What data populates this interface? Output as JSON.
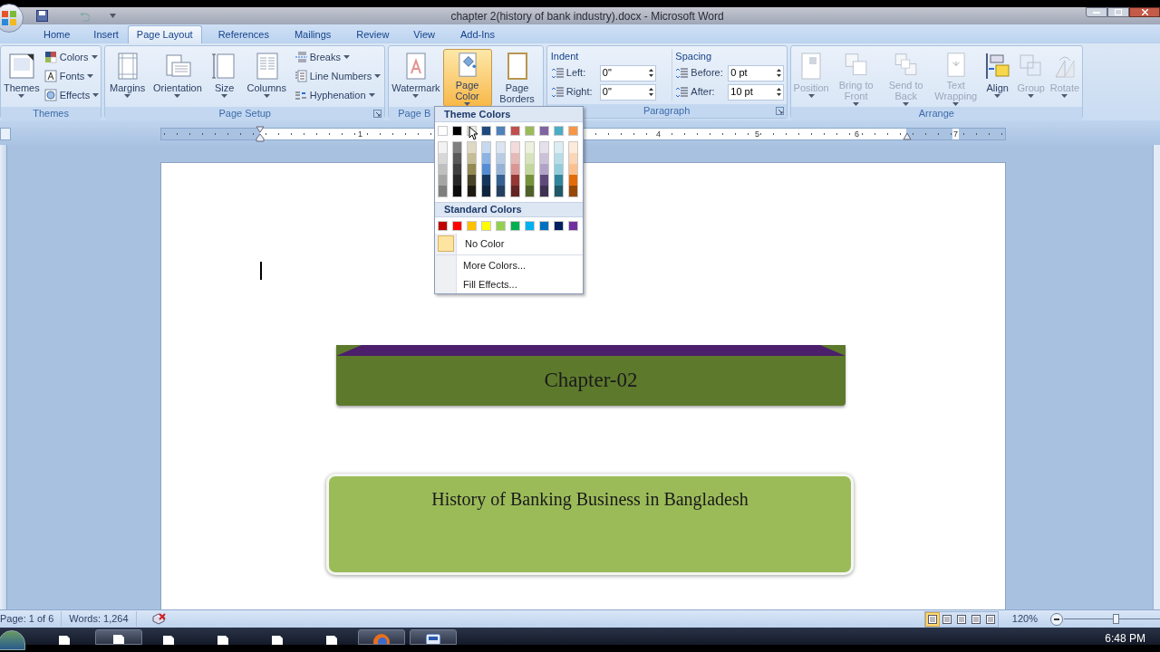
{
  "title_bar": {
    "title": "chapter 2(history of bank industry).docx - Microsoft Word"
  },
  "tabs": [
    {
      "label": "Home",
      "selected": false
    },
    {
      "label": "Insert",
      "selected": false
    },
    {
      "label": "Page Layout",
      "selected": true
    },
    {
      "label": "References",
      "selected": false
    },
    {
      "label": "Mailings",
      "selected": false
    },
    {
      "label": "Review",
      "selected": false
    },
    {
      "label": "View",
      "selected": false
    },
    {
      "label": "Add-Ins",
      "selected": false
    }
  ],
  "ribbon": {
    "groups": [
      {
        "label": "Themes",
        "label_clipped": false,
        "launcher": false,
        "items": [
          {
            "kind": "large",
            "label": "Themes",
            "dropdown": true,
            "disabled": false,
            "pressed": false
          },
          {
            "kind": "small_stack",
            "items": [
              {
                "label": "Colors",
                "dropdown": true
              },
              {
                "label": "Fonts",
                "dropdown": true
              },
              {
                "label": "Effects",
                "dropdown": true
              }
            ]
          }
        ]
      },
      {
        "label": "Page Setup",
        "label_clipped": false,
        "launcher": true,
        "items": [
          {
            "kind": "large",
            "label": "Margins",
            "dropdown": true,
            "disabled": false,
            "pressed": false
          },
          {
            "kind": "large",
            "label": "Orientation",
            "dropdown": true,
            "disabled": false,
            "pressed": false
          },
          {
            "kind": "large",
            "label": "Size",
            "dropdown": true,
            "disabled": false,
            "pressed": false
          },
          {
            "kind": "large",
            "label": "Columns",
            "dropdown": true,
            "disabled": false,
            "pressed": false
          },
          {
            "kind": "small_stack",
            "items": [
              {
                "label": "Breaks",
                "dropdown": true
              },
              {
                "label": "Line Numbers",
                "dropdown": true
              },
              {
                "label": "Hyphenation",
                "dropdown": true
              }
            ]
          }
        ]
      },
      {
        "label": "Page B",
        "label_clipped": true,
        "launcher": false,
        "items": [
          {
            "kind": "large",
            "label": "Watermark",
            "dropdown": true,
            "disabled": false,
            "pressed": false
          },
          {
            "kind": "large",
            "label": "Page Color",
            "dropdown": true,
            "disabled": false,
            "pressed": true
          },
          {
            "kind": "large",
            "label": "Page Borders",
            "dropdown": false,
            "disabled": false,
            "pressed": false
          }
        ]
      },
      {
        "label": "Paragraph",
        "label_clipped": false,
        "launcher": true,
        "items": [
          {
            "kind": "spin_group",
            "heading": "Indent",
            "fields": [
              {
                "label": "Left:",
                "value": "0\""
              },
              {
                "label": "Right:",
                "value": "0\""
              }
            ]
          },
          {
            "kind": "spin_group",
            "heading": "Spacing",
            "fields": [
              {
                "label": "Before:",
                "value": "0 pt"
              },
              {
                "label": "After:",
                "value": "10 pt"
              }
            ]
          }
        ]
      },
      {
        "label": "Arrange",
        "label_clipped": false,
        "launcher": false,
        "items": [
          {
            "kind": "large",
            "label": "Position",
            "dropdown": true,
            "disabled": true,
            "pressed": false
          },
          {
            "kind": "large",
            "label": "Bring to Front",
            "dropdown": true,
            "disabled": true,
            "pressed": false
          },
          {
            "kind": "large",
            "label": "Send to Back",
            "dropdown": true,
            "disabled": true,
            "pressed": false
          },
          {
            "kind": "large",
            "label": "Text Wrapping",
            "dropdown": true,
            "disabled": true,
            "pressed": false
          },
          {
            "kind": "large",
            "label": "Align",
            "dropdown": true,
            "disabled": false,
            "pressed": false
          },
          {
            "kind": "large",
            "label": "Group",
            "dropdown": true,
            "disabled": true,
            "pressed": false
          },
          {
            "kind": "large",
            "label": "Rotate",
            "dropdown": true,
            "disabled": true,
            "pressed": false
          }
        ]
      }
    ]
  },
  "ruler": {
    "numbers": [
      "1",
      "4",
      "5",
      "6",
      "7"
    ]
  },
  "document": {
    "chapter_banner": "Chapter-02",
    "title_banner": "History of Banking Business in Bangladesh"
  },
  "color_menu": {
    "heading": "Theme Colors",
    "theme_colors": [
      {
        "color": "#ffffff",
        "shades": [
          {
            "color": "#f2f2f2"
          },
          {
            "color": "#d8d8d8"
          },
          {
            "color": "#bfbfbf"
          },
          {
            "color": "#a5a5a5"
          },
          {
            "color": "#7f7f7f"
          }
        ]
      },
      {
        "color": "#000000",
        "shades": [
          {
            "color": "#7f7f7f"
          },
          {
            "color": "#595959"
          },
          {
            "color": "#3f3f3f"
          },
          {
            "color": "#262626"
          },
          {
            "color": "#0c0c0c"
          }
        ]
      },
      {
        "color": "#eeece1",
        "shades": [
          {
            "color": "#ddd9c3"
          },
          {
            "color": "#c4bd97"
          },
          {
            "color": "#938953"
          },
          {
            "color": "#494429"
          },
          {
            "color": "#1d1b10"
          }
        ]
      },
      {
        "color": "#1f497d",
        "shades": [
          {
            "color": "#c6d9f0"
          },
          {
            "color": "#8db3e2"
          },
          {
            "color": "#548dd4"
          },
          {
            "color": "#17365d"
          },
          {
            "color": "#0f243e"
          }
        ]
      },
      {
        "color": "#4f81bd",
        "shades": [
          {
            "color": "#dbe5f1"
          },
          {
            "color": "#b8cce4"
          },
          {
            "color": "#95b3d7"
          },
          {
            "color": "#366092"
          },
          {
            "color": "#244061"
          }
        ]
      },
      {
        "color": "#c0504d",
        "shades": [
          {
            "color": "#f2dcdb"
          },
          {
            "color": "#e5b9b7"
          },
          {
            "color": "#d99694"
          },
          {
            "color": "#953734"
          },
          {
            "color": "#632423"
          }
        ]
      },
      {
        "color": "#9bbb59",
        "shades": [
          {
            "color": "#ebf1dd"
          },
          {
            "color": "#d7e3bc"
          },
          {
            "color": "#c3d69b"
          },
          {
            "color": "#76923c"
          },
          {
            "color": "#4f6128"
          }
        ]
      },
      {
        "color": "#8064a2",
        "shades": [
          {
            "color": "#e5e0ec"
          },
          {
            "color": "#ccc1d9"
          },
          {
            "color": "#b2a2c7"
          },
          {
            "color": "#5f497a"
          },
          {
            "color": "#3f3151"
          }
        ]
      },
      {
        "color": "#4bacc6",
        "shades": [
          {
            "color": "#dbeef3"
          },
          {
            "color": "#b7dde8"
          },
          {
            "color": "#92cddc"
          },
          {
            "color": "#31859b"
          },
          {
            "color": "#205867"
          }
        ]
      },
      {
        "color": "#f79646",
        "shades": [
          {
            "color": "#fdeada"
          },
          {
            "color": "#fbd5b5"
          },
          {
            "color": "#fac08f"
          },
          {
            "color": "#e36c09"
          },
          {
            "color": "#974806"
          }
        ]
      }
    ],
    "standard_heading": "Standard Colors",
    "standard_colors": [
      {
        "color": "#c00000"
      },
      {
        "color": "#ff0000"
      },
      {
        "color": "#ffc000"
      },
      {
        "color": "#ffff00"
      },
      {
        "color": "#92d050"
      },
      {
        "color": "#00b050"
      },
      {
        "color": "#00b0f0"
      },
      {
        "color": "#0070c0"
      },
      {
        "color": "#002060"
      },
      {
        "color": "#7030a0"
      }
    ],
    "no_color": "No Color",
    "items": [
      "More Colors...",
      "Fill Effects..."
    ]
  },
  "status_bar": {
    "page": "Page: 1 of 6",
    "words": "Words: 1,264",
    "views": [
      {
        "selected": true
      },
      {
        "selected": false
      },
      {
        "selected": false
      },
      {
        "selected": false
      },
      {
        "selected": false
      }
    ],
    "zoom": "120%",
    "zoom_slider": {
      "level": 0.55
    }
  },
  "taskbar": {
    "buttons": [
      {
        "kind": "document",
        "selected": false
      },
      {
        "kind": "document",
        "selected": true
      },
      {
        "kind": "document",
        "selected": false
      },
      {
        "kind": "document",
        "selected": false
      },
      {
        "kind": "document",
        "selected": false
      },
      {
        "kind": "document",
        "selected": false
      },
      {
        "kind": "browser",
        "selected": true
      },
      {
        "kind": "word",
        "selected": true
      }
    ],
    "clock": "6:48 PM"
  }
}
